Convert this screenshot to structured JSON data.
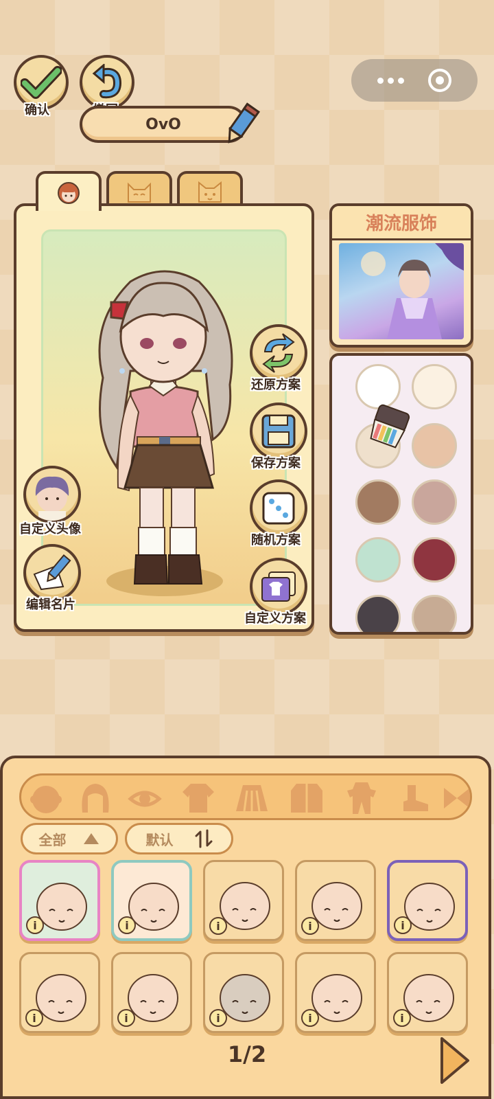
{
  "top": {
    "confirm_label": "确认",
    "undo_label": "撤回",
    "name_value": "OvO"
  },
  "actions": {
    "restore": "还原方案",
    "save": "保存方案",
    "random": "随机方案",
    "custom_scheme": "自定义方案",
    "custom_avatar": "自定义头像",
    "edit_card": "编辑名片"
  },
  "trend": {
    "title": "潮流服饰"
  },
  "palette": {
    "colors": [
      "#ffffff",
      "#fbf1e2",
      "#efe0cc",
      "#e8c3a6",
      "#a27b61",
      "#c9a69c",
      "#bfe2d0",
      "#8f3540",
      "#4a4248",
      "#c7ab94"
    ]
  },
  "filters": {
    "all_label": "全部",
    "sort_label": "默认"
  },
  "categories": [
    "face-icon",
    "hair-icon",
    "eye-icon",
    "top-icon",
    "skirt-icon",
    "coat-icon",
    "outfit-icon",
    "shoe-icon",
    "bow-icon"
  ],
  "items": [
    {
      "bg": "#dfeedd",
      "border": "#e884c4",
      "info": "i"
    },
    {
      "bg": "#fde9d5",
      "border": "#8ec9c0",
      "info": "i"
    },
    {
      "bg": "#f8dba7",
      "border": "#c59a62",
      "info": "i"
    },
    {
      "bg": "#f8dba7",
      "border": "#c59a62",
      "info": "i"
    },
    {
      "bg": "#f8dba7",
      "border": "#7b61b8",
      "info": "i"
    },
    {
      "bg": "#f8dba7",
      "border": "#c59a62",
      "info": "i"
    },
    {
      "bg": "#f8dba7",
      "border": "#c59a62",
      "info": "i"
    },
    {
      "bg": "#f8dba7",
      "border": "#c59a62",
      "info": "i"
    },
    {
      "bg": "#f8dba7",
      "border": "#c59a62",
      "info": "i"
    },
    {
      "bg": "#f8dba7",
      "border": "#c59a62",
      "info": "i"
    }
  ],
  "pager": {
    "text": "1/2"
  }
}
